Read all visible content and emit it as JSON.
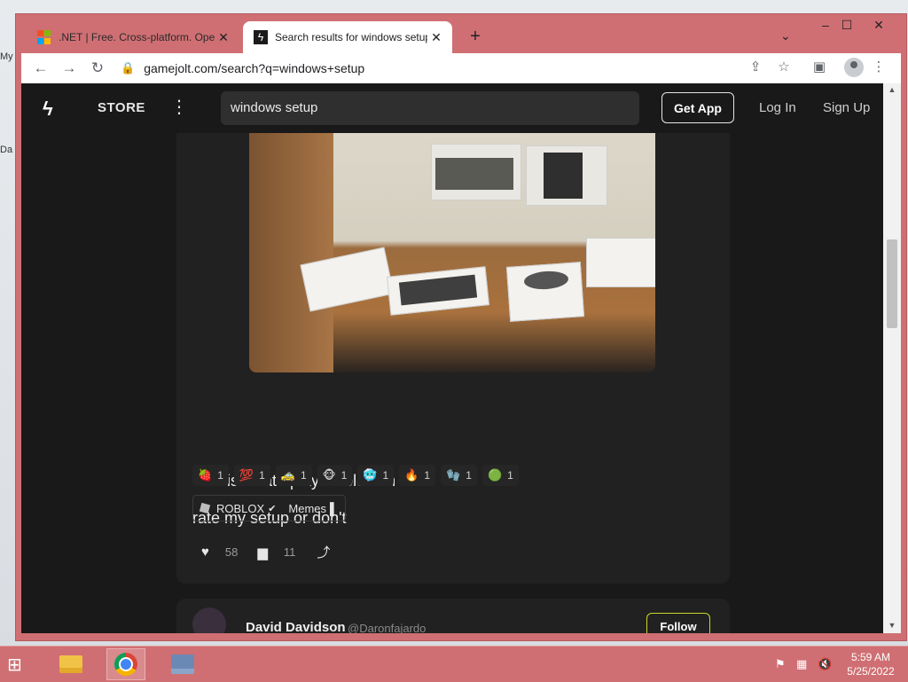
{
  "desktop": {
    "label_top": "My",
    "label_mid": "Da"
  },
  "browser": {
    "tabs": [
      {
        "title": ".NET | Free. Cross-platform. Open",
        "close": "✕"
      },
      {
        "title": "Search results for windows setup",
        "close": "✕"
      }
    ],
    "new_tab": "+",
    "tab_menu": "⌄",
    "window_controls": {
      "minimize": "–",
      "maximize": "☐",
      "close": "✕"
    },
    "nav": {
      "back": "←",
      "forward": "→",
      "reload": "↻"
    },
    "url": "gamejolt.com/search?q=windows+setup",
    "toolbar_icons": {
      "share": "⇪",
      "star": "☆",
      "sidepanel": "▣",
      "menu": "⋮"
    }
  },
  "gamejolt": {
    "header": {
      "logo": "ϟ",
      "store": "STORE",
      "more": "⋮",
      "search_value": "windows setup",
      "get_app": "Get App",
      "login": "Log In",
      "signup": "Sign Up"
    },
    "post": {
      "line1": "This is what I play Roblox on",
      "line2": "rate my setup or don't",
      "reactions": [
        {
          "emoji": "🍓",
          "count": "1"
        },
        {
          "emoji": "💯",
          "count": "1"
        },
        {
          "emoji": "🚕",
          "count": "1"
        },
        {
          "emoji": "🐵",
          "count": "1"
        },
        {
          "emoji": "🥶",
          "count": "1"
        },
        {
          "emoji": "🔥",
          "count": "1"
        },
        {
          "emoji": "🧤",
          "count": "1"
        },
        {
          "emoji": "🟢",
          "count": "1"
        }
      ],
      "tags": {
        "roblox": "ROBLOX",
        "verified": "✔",
        "memes": "Memes",
        "memes_end": "▌"
      },
      "likes": "58",
      "comments": "11",
      "like_icon": "♥",
      "comment_icon": "▆",
      "share_icon": "⤴"
    },
    "next_post": {
      "author": "David Davidson",
      "handle": "@Daronfajardo",
      "follow": "Follow"
    }
  },
  "taskbar": {
    "start": "⊞",
    "time": "5:59 AM",
    "date": "5/25/2022",
    "tray": {
      "flag": "⚑",
      "network": "▦",
      "volume": "🔇"
    }
  }
}
